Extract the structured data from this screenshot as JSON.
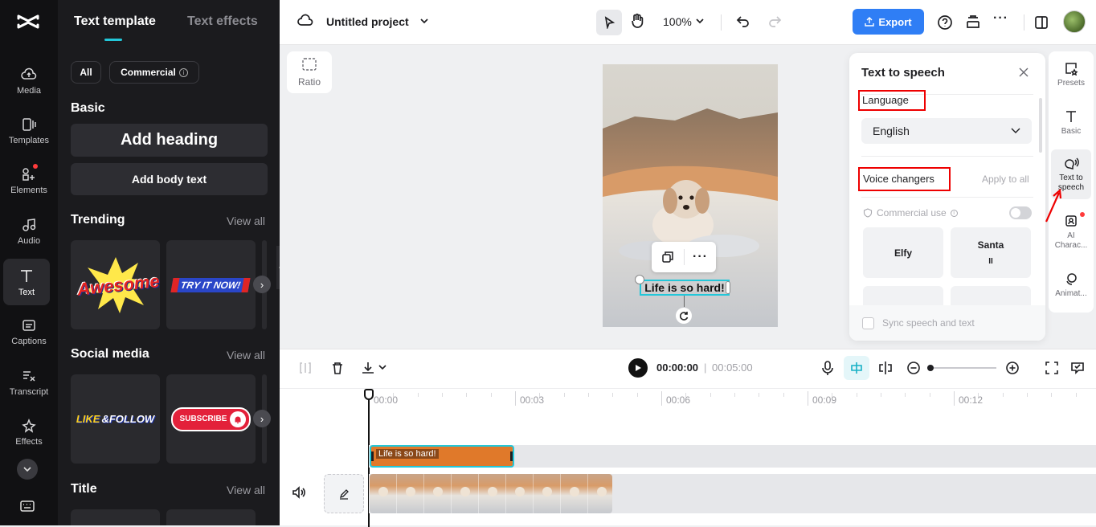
{
  "rail": {
    "items": [
      {
        "label": "Media",
        "icon": "media-cloud-icon"
      },
      {
        "label": "Templates",
        "icon": "templates-icon"
      },
      {
        "label": "Elements",
        "icon": "elements-icon"
      },
      {
        "label": "Audio",
        "icon": "audio-note-icon"
      },
      {
        "label": "Text",
        "icon": "text-icon"
      },
      {
        "label": "Captions",
        "icon": "captions-icon"
      },
      {
        "label": "Transcript",
        "icon": "transcript-icon"
      },
      {
        "label": "Effects",
        "icon": "effects-icon"
      }
    ]
  },
  "panel": {
    "tabs": [
      "Text template",
      "Text effects"
    ],
    "filters": {
      "all": "All",
      "commercial": "Commercial"
    },
    "basic": {
      "title": "Basic",
      "add_heading": "Add heading",
      "add_body": "Add body text"
    },
    "trending": {
      "title": "Trending",
      "view_all": "View all",
      "t1": "Awesome!",
      "t2": "TRY IT NOW!"
    },
    "social": {
      "title": "Social media",
      "view_all": "View all",
      "t1a": "LIKE",
      "t1b": "&FOLLOW",
      "t2": "SUBSCRIBE"
    },
    "title_section": {
      "title": "Title",
      "view_all": "View all"
    }
  },
  "topbar": {
    "project_name": "Untitled project",
    "zoom": "100%",
    "export": "Export",
    "accent": "#2f7ef5"
  },
  "canvas": {
    "ratio": "Ratio",
    "caption": "Life is so hard!"
  },
  "tts": {
    "title": "Text to speech",
    "language_label": "Language",
    "language_value": "English",
    "voice_changers": "Voice changers",
    "apply_all": "Apply to all",
    "commercial_use": "Commercial use",
    "voices": [
      {
        "name": "Elfy"
      },
      {
        "name": "Santa",
        "sub": "II"
      }
    ],
    "sync": "Sync speech and text"
  },
  "right_rail": {
    "items": [
      {
        "label": "Presets",
        "icon": "presets-icon"
      },
      {
        "label": "Basic",
        "icon": "basic-text-icon"
      },
      {
        "label": "Text to speech",
        "icon": "text-to-speech-icon"
      },
      {
        "label": "AI Charac...",
        "icon": "ai-character-icon"
      },
      {
        "label": "Animat...",
        "icon": "animation-icon"
      }
    ]
  },
  "timeline": {
    "current_time": "00:00:00",
    "total_time": "00:05:00",
    "ticks": [
      "00:00",
      "00:03",
      "00:06",
      "00:09",
      "00:12"
    ],
    "text_clip": "Life is so hard!"
  }
}
